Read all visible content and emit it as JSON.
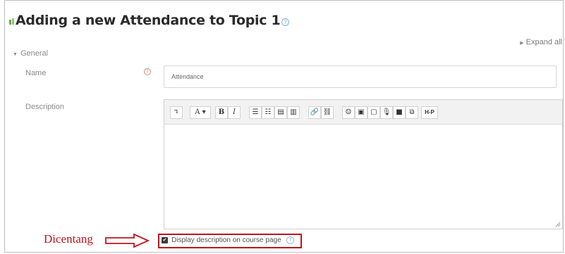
{
  "page": {
    "title": "Adding a new Attendance to Topic 1",
    "expand_all": "Expand all",
    "title_help": "?"
  },
  "section": {
    "name": "General"
  },
  "form": {
    "name_label": "Name",
    "name_value": "Attendance",
    "required_icon": "required-icon",
    "description_label": "Description",
    "description_value": ""
  },
  "editor": {
    "toolbar": [
      {
        "name": "collapse-toolbar-button",
        "glyph": "↴"
      },
      {
        "name": "font-style-button",
        "glyph": "A ▾"
      },
      {
        "name": "bold-button",
        "glyph": "B"
      },
      {
        "name": "italic-button",
        "glyph": "I"
      },
      {
        "name": "unordered-list-button",
        "glyph": "☰"
      },
      {
        "name": "ordered-list-button",
        "glyph": "☷"
      },
      {
        "name": "indent-button",
        "glyph": "▤"
      },
      {
        "name": "outdent-button",
        "glyph": "▥"
      },
      {
        "name": "link-button",
        "glyph": "🔗"
      },
      {
        "name": "unlink-button",
        "glyph": "⛓"
      },
      {
        "name": "emoticon-button",
        "glyph": "☺"
      },
      {
        "name": "image-button",
        "glyph": "▣"
      },
      {
        "name": "media-button",
        "glyph": "▢"
      },
      {
        "name": "record-audio-button",
        "glyph": "🎙"
      },
      {
        "name": "record-video-button",
        "glyph": "■"
      },
      {
        "name": "manage-files-button",
        "glyph": "⧉"
      },
      {
        "name": "h5p-button",
        "glyph": "H-P"
      }
    ]
  },
  "checkbox": {
    "label": "Display description on course page",
    "checked": true,
    "help": "?"
  },
  "annotation": {
    "text": "Dicentang",
    "color": "#c0141b"
  }
}
